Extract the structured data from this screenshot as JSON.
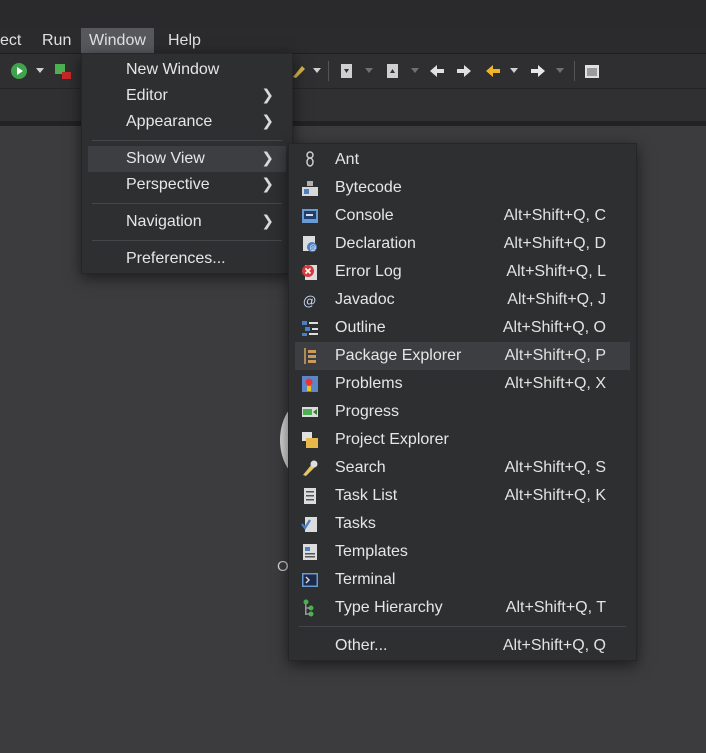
{
  "menubar": {
    "items": [
      "ect",
      "Run",
      "Window",
      "Help"
    ],
    "active": "Window"
  },
  "window_menu": {
    "items": [
      {
        "label": "New Window",
        "submenu": false
      },
      {
        "label": "Editor",
        "submenu": true
      },
      {
        "label": "Appearance",
        "submenu": true
      },
      {
        "label": "Show View",
        "submenu": true,
        "highlighted": true
      },
      {
        "label": "Perspective",
        "submenu": true
      },
      {
        "label": "Navigation",
        "submenu": true
      },
      {
        "label": "Preferences...",
        "submenu": false
      }
    ]
  },
  "show_view_menu": {
    "items": [
      {
        "label": "Ant",
        "shortcut": "",
        "icon": "ant-icon"
      },
      {
        "label": "Bytecode",
        "shortcut": "",
        "icon": "bytecode-icon"
      },
      {
        "label": "Console",
        "shortcut": "Alt+Shift+Q, C",
        "icon": "console-icon"
      },
      {
        "label": "Declaration",
        "shortcut": "Alt+Shift+Q, D",
        "icon": "declaration-icon"
      },
      {
        "label": "Error Log",
        "shortcut": "Alt+Shift+Q, L",
        "icon": "error-log-icon"
      },
      {
        "label": "Javadoc",
        "shortcut": "Alt+Shift+Q, J",
        "icon": "javadoc-icon"
      },
      {
        "label": "Outline",
        "shortcut": "Alt+Shift+Q, O",
        "icon": "outline-icon"
      },
      {
        "label": "Package Explorer",
        "shortcut": "Alt+Shift+Q, P",
        "icon": "package-explorer-icon",
        "highlighted": true
      },
      {
        "label": "Problems",
        "shortcut": "Alt+Shift+Q, X",
        "icon": "problems-icon"
      },
      {
        "label": "Progress",
        "shortcut": "",
        "icon": "progress-icon"
      },
      {
        "label": "Project Explorer",
        "shortcut": "",
        "icon": "project-explorer-icon"
      },
      {
        "label": "Search",
        "shortcut": "Alt+Shift+Q, S",
        "icon": "search-icon"
      },
      {
        "label": "Task List",
        "shortcut": "Alt+Shift+Q, K",
        "icon": "task-list-icon"
      },
      {
        "label": "Tasks",
        "shortcut": "",
        "icon": "tasks-icon"
      },
      {
        "label": "Templates",
        "shortcut": "",
        "icon": "templates-icon"
      },
      {
        "label": "Terminal",
        "shortcut": "",
        "icon": "terminal-icon"
      },
      {
        "label": "Type Hierarchy",
        "shortcut": "Alt+Shift+Q, T",
        "icon": "type-hierarchy-icon"
      }
    ],
    "other": {
      "label": "Other...",
      "shortcut": "Alt+Shift+Q, Q"
    }
  },
  "editor": {
    "partial_letter": "O"
  },
  "colors": {
    "background": "#3f3f41",
    "menu": "#2e2f31",
    "highlight": "#3d3e41",
    "menubar_active": "#56585c"
  }
}
